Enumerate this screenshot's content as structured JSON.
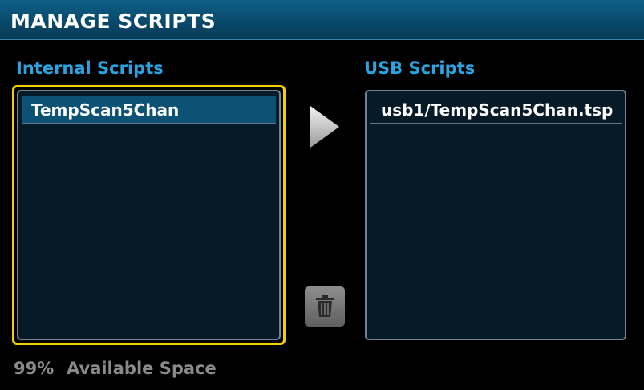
{
  "header": {
    "title": "MANAGE SCRIPTS"
  },
  "internal": {
    "label": "Internal Scripts",
    "items": [
      "TempScan5Chan"
    ]
  },
  "usb": {
    "label": "USB Scripts",
    "items": [
      "usb1/TempScan5Chan.tsp"
    ]
  },
  "actions": {
    "copy_icon": "right-triangle-arrow-icon",
    "delete_icon": "trash-icon"
  },
  "footer": {
    "percent": "99%",
    "available_label": "Available Space"
  },
  "colors": {
    "accent_label": "#2aa3e0",
    "focus_border": "#f2cf00",
    "selection": "#0c5275",
    "title_bar": "#0a4a6c"
  }
}
